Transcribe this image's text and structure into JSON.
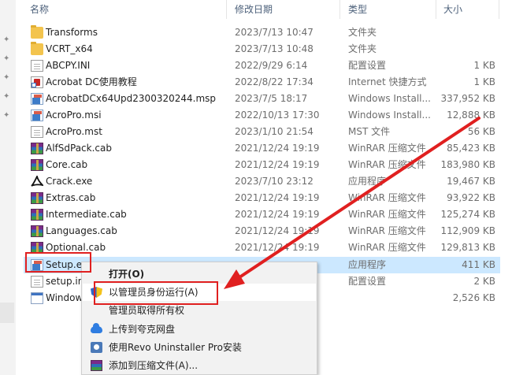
{
  "columns": {
    "name": "名称",
    "modified": "修改日期",
    "type": "类型",
    "size": "大小"
  },
  "files": [
    {
      "icon": "folder-icon",
      "kind": "folder",
      "name": "Transforms",
      "modified": "2023/7/13 10:47",
      "type": "文件夹",
      "size": ""
    },
    {
      "icon": "folder-icon",
      "kind": "folder",
      "name": "VCRT_x64",
      "modified": "2023/7/13 10:48",
      "type": "文件夹",
      "size": ""
    },
    {
      "icon": "ini-file-icon",
      "kind": "doc",
      "name": "ABCPY.INI",
      "modified": "2022/9/29 6:14",
      "type": "配置设置",
      "size": "1 KB"
    },
    {
      "icon": "internet-shortcut-icon",
      "kind": "pdfshort",
      "name": "Acrobat DC使用教程",
      "modified": "2022/8/22 17:34",
      "type": "Internet 快捷方式",
      "size": "1 KB"
    },
    {
      "icon": "msp-installer-icon",
      "kind": "msi",
      "name": "AcrobatDCx64Upd2300320244.msp",
      "modified": "2023/7/5 18:17",
      "type": "Windows Install...",
      "size": "337,952 KB"
    },
    {
      "icon": "msi-installer-icon",
      "kind": "msi",
      "name": "AcroPro.msi",
      "modified": "2022/10/13 17:30",
      "type": "Windows Install...",
      "size": "12,888 KB"
    },
    {
      "icon": "mst-file-icon",
      "kind": "doc",
      "name": "AcroPro.mst",
      "modified": "2023/1/10 21:54",
      "type": "MST 文件",
      "size": "56 KB"
    },
    {
      "icon": "winrar-archive-icon",
      "kind": "cab",
      "name": "AlfSdPack.cab",
      "modified": "2021/12/24 19:19",
      "type": "WinRAR 压缩文件",
      "size": "85,423 KB"
    },
    {
      "icon": "winrar-archive-icon",
      "kind": "cab",
      "name": "Core.cab",
      "modified": "2021/12/24 19:19",
      "type": "WinRAR 压缩文件",
      "size": "183,980 KB"
    },
    {
      "icon": "acrobat-exe-icon",
      "kind": "acro",
      "name": "Crack.exe",
      "modified": "2023/7/10 23:12",
      "type": "应用程序",
      "size": "19,467 KB"
    },
    {
      "icon": "winrar-archive-icon",
      "kind": "cab",
      "name": "Extras.cab",
      "modified": "2021/12/24 19:19",
      "type": "WinRAR 压缩文件",
      "size": "93,922 KB"
    },
    {
      "icon": "winrar-archive-icon",
      "kind": "cab",
      "name": "Intermediate.cab",
      "modified": "2021/12/24 19:19",
      "type": "WinRAR 压缩文件",
      "size": "125,274 KB"
    },
    {
      "icon": "winrar-archive-icon",
      "kind": "cab",
      "name": "Languages.cab",
      "modified": "2021/12/24 19:19",
      "type": "WinRAR 压缩文件",
      "size": "112,909 KB"
    },
    {
      "icon": "winrar-archive-icon",
      "kind": "cab",
      "name": "Optional.cab",
      "modified": "2021/12/24 19:19",
      "type": "WinRAR 压缩文件",
      "size": "129,813 KB"
    },
    {
      "icon": "setup-exe-icon",
      "kind": "msi",
      "name": "Setup.e",
      "modified": "",
      "type": "应用程序",
      "size": "411 KB",
      "selected": true
    },
    {
      "icon": "ini-file-icon",
      "kind": "doc",
      "name": "setup.ini",
      "modified": "",
      "type": "配置设置",
      "size": "2 KB"
    },
    {
      "icon": "windows-installer-icon",
      "kind": "exe",
      "name": "Window",
      "modified": "",
      "type": "",
      "size": "2,526 KB"
    }
  ],
  "context_menu": {
    "items": [
      {
        "icon": "",
        "label": "打开(O)",
        "bold": true
      },
      {
        "icon": "uac-shield-icon",
        "label": "以管理员身份运行(A)",
        "bold": false,
        "highlighted": true
      },
      {
        "icon": "",
        "label": "管理员取得所有权",
        "bold": false
      },
      {
        "icon": "cloud-upload-icon",
        "label": "上传到夸克网盘",
        "bold": false
      },
      {
        "icon": "revo-uninstaller-icon",
        "label": "使用Revo Uninstaller Pro安装",
        "bold": false
      },
      {
        "icon": "winrar-archive-icon",
        "label": "添加到压缩文件(A)...",
        "bold": false
      }
    ]
  },
  "annotation": {
    "color": "#e02020"
  }
}
